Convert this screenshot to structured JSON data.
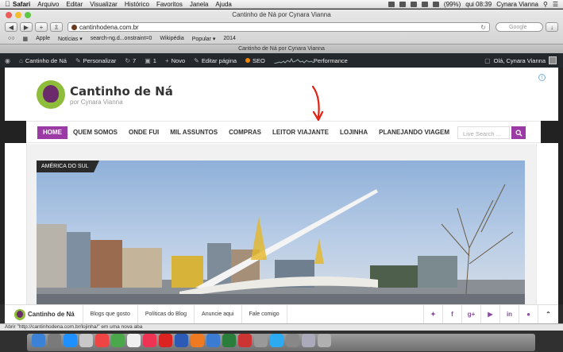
{
  "menubar": {
    "app": "Safari",
    "items": [
      "Arquivo",
      "Editar",
      "Visualizar",
      "Histórico",
      "Favoritos",
      "Janela",
      "Ajuda"
    ],
    "battery": "(99%)",
    "clock": "qui 08:39",
    "user": "Cynara Vianna"
  },
  "browser": {
    "window_title": "Cantinho de Ná por Cynara Vianna",
    "url": "cantinhodena.com.br",
    "search_placeholder": "Google",
    "bookmarks": [
      "Apple",
      "Notícias ▾",
      "search-ng.d...onstraint=0",
      "Wikipédia",
      "Popular ▾",
      "2014"
    ],
    "tab_title": "Cantinho de Ná por Cynara Vianna"
  },
  "adminbar": {
    "site_name": "Cantinho de Ná",
    "customize": "Personalizar",
    "updates": "7",
    "comments": "1",
    "new": "Novo",
    "edit_page": "Editar página",
    "seo": "SEO",
    "performance": "Performance",
    "howdy": "Olá, Cynara Vianna"
  },
  "site": {
    "title": "Cantinho de Ná",
    "tagline": "por Cynara Vianna",
    "nav": [
      "HOME",
      "QUEM SOMOS",
      "ONDE FUI",
      "MIL ASSUNTOS",
      "COMPRAS",
      "LEITOR VIAJANTE",
      "LOJINHA",
      "PLANEJANDO VIAGEM"
    ],
    "search_placeholder": "Live Search ...",
    "category_badge": "AMÉRICA DO SUL"
  },
  "footer": {
    "logo_text": "Cantinho de Ná",
    "links": [
      "Blogs que gosto",
      "Políticas do Blog",
      "Anuncie aqui",
      "Fale comigo"
    ],
    "social": [
      "twitter",
      "facebook",
      "google-plus",
      "youtube",
      "linkedin",
      "rss"
    ]
  },
  "statusbar": {
    "text": "Abrir \"http://cantinhodena.com.br/lojinha/\" em uma nova aba"
  },
  "colors": {
    "accent": "#9b3aa5",
    "admin_bar": "#23282d",
    "arrow": "#e02010"
  }
}
